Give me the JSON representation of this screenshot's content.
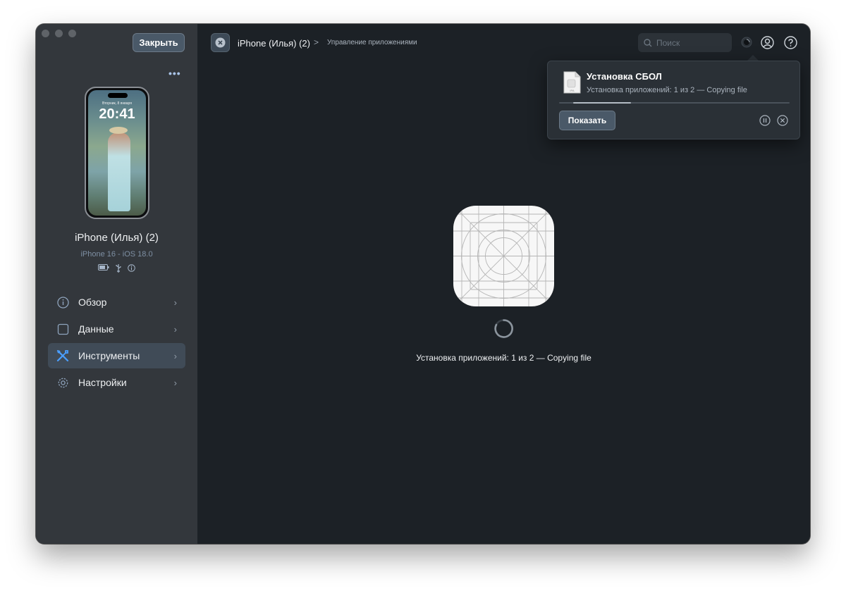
{
  "sidebar": {
    "close_label": "Закрыть",
    "more_label": "•••",
    "phone": {
      "date": "Вторник, 8 января",
      "time": "20:41"
    },
    "device_name": "iPhone (Илья) (2)",
    "device_model": "iPhone 16 - iOS 18.0",
    "status_icons": [
      "battery-icon",
      "usb-icon",
      "info-icon"
    ],
    "items": [
      {
        "label": "Обзор",
        "icon": "info-circle-icon",
        "active": false
      },
      {
        "label": "Данные",
        "icon": "square-icon",
        "active": false
      },
      {
        "label": "Инструменты",
        "icon": "tools-icon",
        "active": true
      },
      {
        "label": "Настройки",
        "icon": "gear-icon",
        "active": false
      }
    ]
  },
  "header": {
    "device": "iPhone (Илья) (2)",
    "separator": ">",
    "page": "Управление приложениями",
    "search_placeholder": "Поиск"
  },
  "popover": {
    "title": "Установка СБОЛ",
    "status": "Установка приложений: 1 из 2 — Copying file",
    "progress": 0.25,
    "show_label": "Показать"
  },
  "main": {
    "install_status": "Установка приложений: 1 из 2 — Copying file"
  },
  "colors": {
    "accent": "#4a9eff",
    "sidebar_bg": "#33373c",
    "main_bg": "#1c2126",
    "active_item": "#404b57"
  }
}
